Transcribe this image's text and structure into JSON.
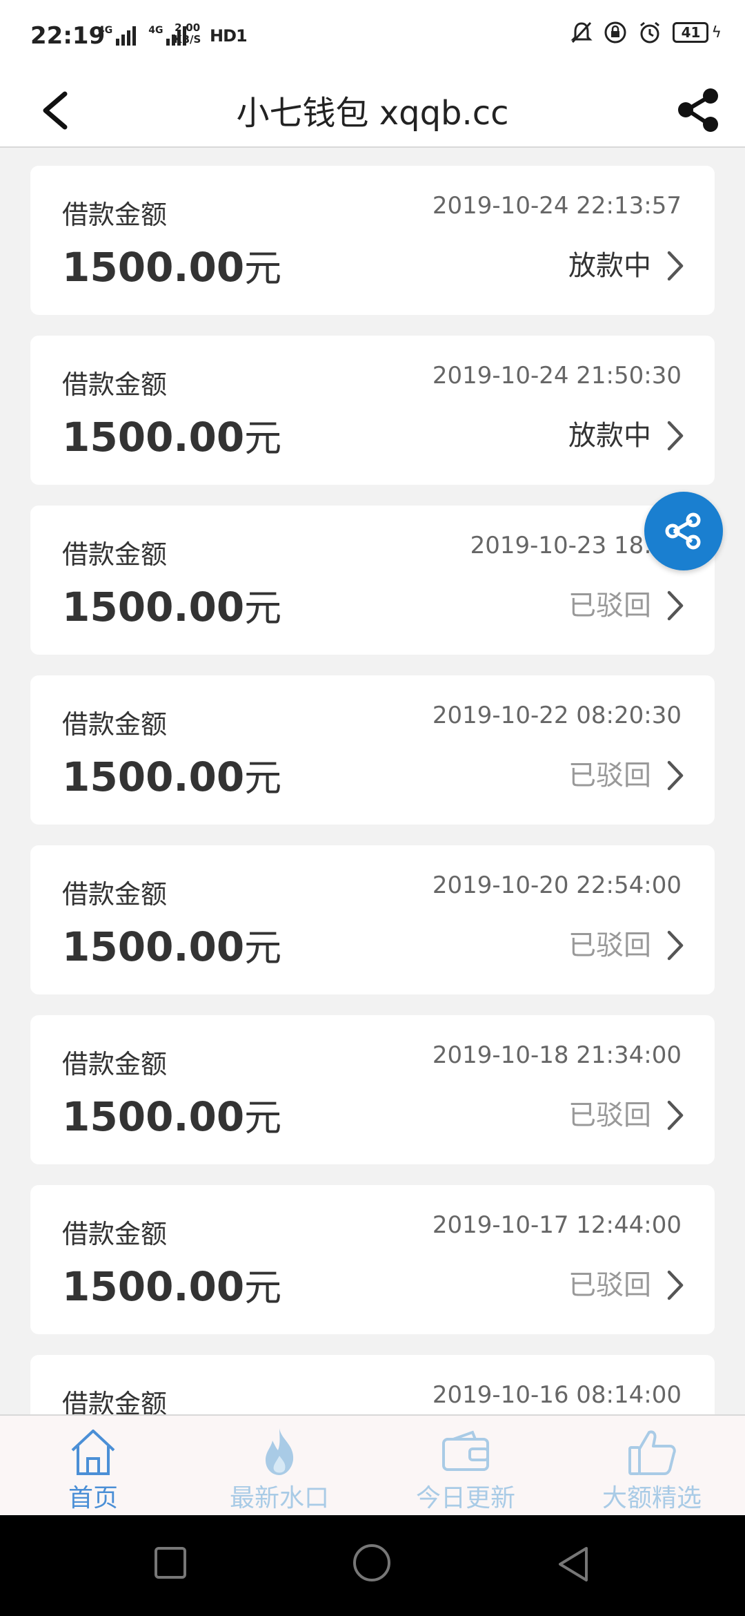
{
  "status_bar": {
    "time": "22:19",
    "net_tag": "4G",
    "net_speed_value": "2.00",
    "net_speed_unit": "KB/S",
    "hd": "HD1",
    "battery": "41"
  },
  "nav": {
    "title": "小七钱包 xqqb.cc",
    "back_icon": "chevron-left-icon",
    "share_icon": "share-icon"
  },
  "loans": [
    {
      "label": "借款金额",
      "date": "2019-10-24 22:13:57",
      "amount": "1500.00",
      "unit": "元",
      "status": "放款中",
      "state": "pending"
    },
    {
      "label": "借款金额",
      "date": "2019-10-24 21:50:30",
      "amount": "1500.00",
      "unit": "元",
      "status": "放款中",
      "state": "pending"
    },
    {
      "label": "借款金额",
      "date": "2019-10-23 18:04",
      "amount": "1500.00",
      "unit": "元",
      "status": "已驳回",
      "state": "rejected"
    },
    {
      "label": "借款金额",
      "date": "2019-10-22 08:20:30",
      "amount": "1500.00",
      "unit": "元",
      "status": "已驳回",
      "state": "rejected"
    },
    {
      "label": "借款金额",
      "date": "2019-10-20 22:54:00",
      "amount": "1500.00",
      "unit": "元",
      "status": "已驳回",
      "state": "rejected"
    },
    {
      "label": "借款金额",
      "date": "2019-10-18 21:34:00",
      "amount": "1500.00",
      "unit": "元",
      "status": "已驳回",
      "state": "rejected"
    },
    {
      "label": "借款金额",
      "date": "2019-10-17 12:44:00",
      "amount": "1500.00",
      "unit": "元",
      "status": "已驳回",
      "state": "rejected"
    },
    {
      "label": "借款金额",
      "date": "2019-10-16 08:14:00",
      "amount": "",
      "unit": "",
      "status": "",
      "state": "rejected"
    }
  ],
  "tabs": [
    {
      "label": "首页",
      "icon": "home-icon",
      "active": true
    },
    {
      "label": "最新水口",
      "icon": "flame-icon",
      "active": false
    },
    {
      "label": "今日更新",
      "icon": "wallet-icon",
      "active": false
    },
    {
      "label": "大额精选",
      "icon": "thumbs-up-icon",
      "active": false
    }
  ],
  "colors": {
    "accent": "#1a7fd0",
    "tab_active": "#4b8fd6",
    "tab_inactive": "#a9cbe6",
    "status_pending": "#333333",
    "status_rejected": "#999999"
  }
}
